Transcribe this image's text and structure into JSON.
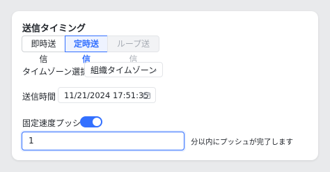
{
  "section": {
    "title": "送信タイミング"
  },
  "timing_options": [
    {
      "label": "即時送信"
    },
    {
      "label": "定時送信"
    },
    {
      "label": "ループ送信"
    }
  ],
  "timezone": {
    "label": "タイムゾーン選択",
    "value": "組織タイムゾーン",
    "icon": "chevron-down-icon"
  },
  "send_time": {
    "label": "送信時間",
    "value": "11/21/2024 17:51:35",
    "icon": "calendar-icon"
  },
  "fixed_speed": {
    "label": "固定速度プッシュ",
    "enabled": true
  },
  "push_minutes": {
    "value": "1",
    "suffix": "分以内にプッシュが完了します"
  },
  "colors": {
    "accent": "#3370ff",
    "disabled": "#a6abb3"
  }
}
